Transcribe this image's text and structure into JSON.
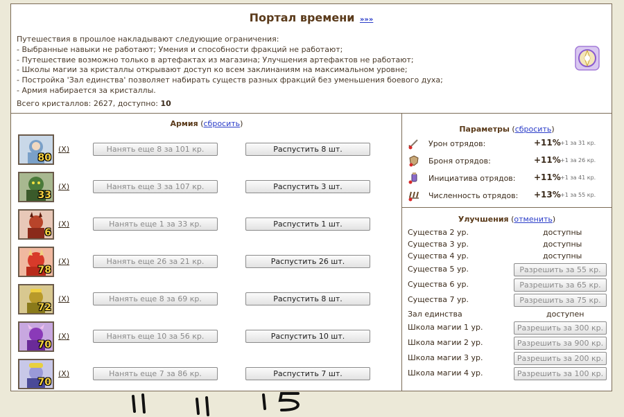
{
  "header": {
    "title": "Портал времени",
    "title_link": "»»»",
    "intro": "Путешествия в прошлое накладывают следующие ограничения:",
    "restrictions": [
      "- Выбранные навыки не работают; Умения и способности фракций не работают;",
      "- Путешествие возможно только в артефактах из магазина; Улучшения артефактов не работают;",
      "- Школы магии за кристаллы открывают доступ ко всем заклинаниям на максимальном уровне;",
      "- Постройка 'Зал единства' позволяет набирать существ разных фракций без уменьшения боевого духа;",
      "- Армия набирается за кристаллы."
    ],
    "crystals_label": "Всего кристаллов: 2627, доступно:",
    "crystals_available": "10",
    "crystal_icon": "crystal-icon"
  },
  "army": {
    "title": "Армия",
    "reset_open": "(",
    "reset_link": "сбросить",
    "reset_close": ")",
    "remove_label": "(X)",
    "rows": [
      {
        "count": "80",
        "hire": "Нанять еще 8 за 101 кр.",
        "dismiss": "Распустить 8 шт.",
        "color": "#7aa0c8"
      },
      {
        "count": "33",
        "hire": "Нанять еще 3 за 107 кр.",
        "dismiss": "Распустить 3 шт.",
        "color": "#4a7a3a"
      },
      {
        "count": "6",
        "hire": "Нанять еще 1 за 33 кр.",
        "dismiss": "Распустить 1 шт.",
        "color": "#b8442a"
      },
      {
        "count": "78",
        "hire": "Нанять еще 26 за 21 кр.",
        "dismiss": "Распустить 26 шт.",
        "color": "#d83a2a"
      },
      {
        "count": "72",
        "hire": "Нанять еще 8 за 69 кр.",
        "dismiss": "Распустить 8 шт.",
        "color": "#b89a2a"
      },
      {
        "count": "70",
        "hire": "Нанять еще 10 за 56 кр.",
        "dismiss": "Распустить 10 шт.",
        "color": "#8a3ab8"
      },
      {
        "count": "70",
        "hire": "Нанять еще 7 за 86 кр.",
        "dismiss": "Распустить 7 шт.",
        "color": "#6a6ac8"
      }
    ]
  },
  "params": {
    "title": "Параметры",
    "reset_open": "(",
    "reset_link": "сбросить",
    "reset_close": ")",
    "rows": [
      {
        "icon": "sword-icon",
        "label": "Урон отрядов:",
        "value": "+11%",
        "note": "+1 за 31 кр."
      },
      {
        "icon": "shield-icon",
        "label": "Броня отрядов:",
        "value": "+11%",
        "note": "+1 за 26 кр."
      },
      {
        "icon": "potion-icon",
        "label": "Инициатива отрядов:",
        "value": "+11%",
        "note": "+1 за 41 кр."
      },
      {
        "icon": "troops-icon",
        "label": "Численность отрядов:",
        "value": "+13%",
        "note": "+1 за 55 кр."
      }
    ]
  },
  "upgrades": {
    "title": "Улучшения",
    "cancel_open": "(",
    "cancel_link": "отменить",
    "cancel_close": ")",
    "rows": [
      {
        "label": "Существа 2 ур.",
        "status": "доступны"
      },
      {
        "label": "Существа 3 ур.",
        "status": "доступны"
      },
      {
        "label": "Существа 4 ур.",
        "status": "доступны"
      },
      {
        "label": "Существа 5 ур.",
        "button": "Разрешить за 55 кр."
      },
      {
        "label": "Существа 6 ур.",
        "button": "Разрешить за 65 кр."
      },
      {
        "label": "Существа 7 ур.",
        "button": "Разрешить за 75 кр."
      },
      {
        "label": "Зал единства",
        "status": "доступен"
      },
      {
        "label": "Школа магии 1 ур.",
        "button": "Разрешить за 300 кр."
      },
      {
        "label": "Школа магии 2 ур.",
        "button": "Разрешить за 900 кр."
      },
      {
        "label": "Школа магии 3 ур.",
        "button": "Разрешить за 200 кр."
      },
      {
        "label": "Школа магии 4 ур.",
        "button": "Разрешить за 100 кр."
      }
    ]
  },
  "annotation": {
    "marks": [
      "11",
      "11",
      "15"
    ]
  }
}
